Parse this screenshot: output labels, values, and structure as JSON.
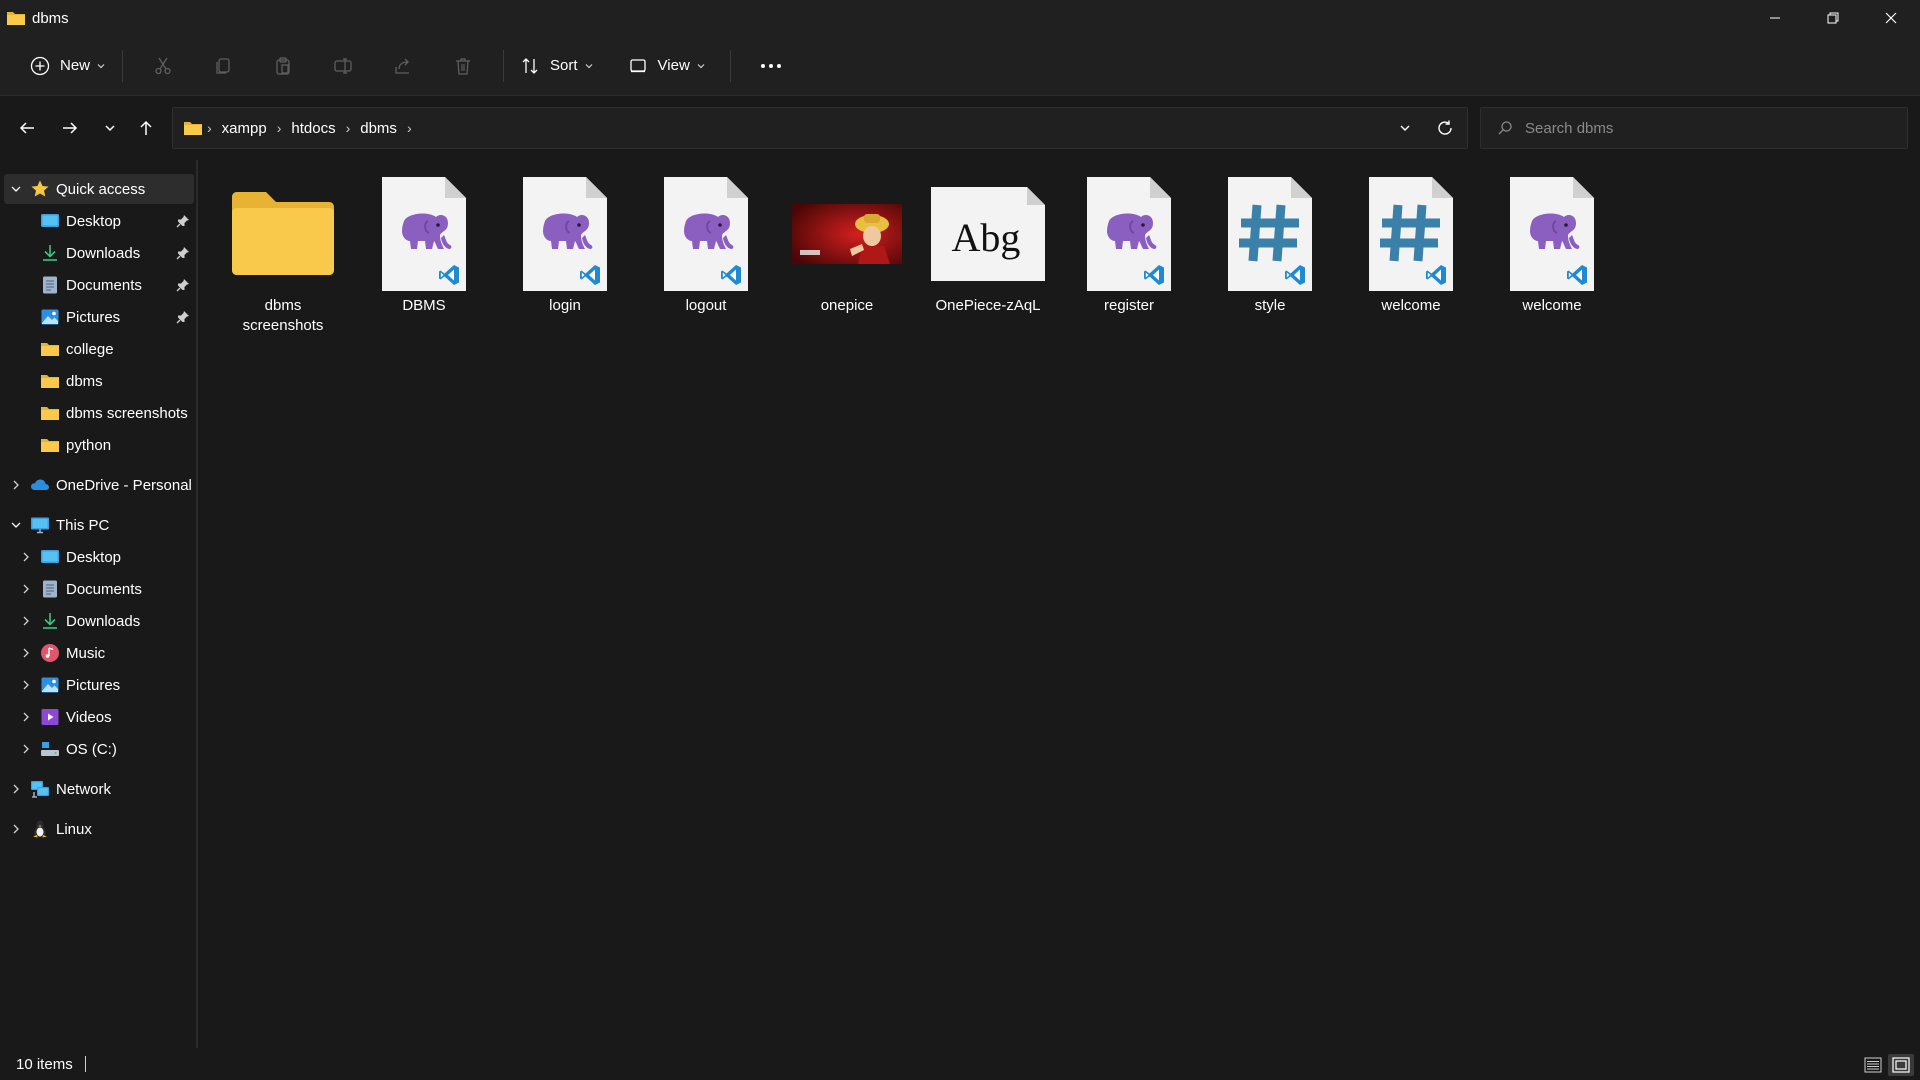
{
  "window": {
    "title": "dbms",
    "minimize_icon": "minimize-icon",
    "maximize_icon": "restore-icon",
    "close_icon": "close-icon"
  },
  "command_bar": {
    "new_label": "New",
    "sort_label": "Sort",
    "view_label": "View",
    "icons": [
      "cut-icon",
      "copy-icon",
      "paste-icon",
      "rename-icon",
      "share-icon",
      "delete-icon",
      "more-icon"
    ]
  },
  "address_bar": {
    "crumbs": [
      "xampp",
      "htdocs",
      "dbms"
    ],
    "search_placeholder": "Search dbms"
  },
  "sidebar": {
    "quick_access": {
      "label": "Quick access",
      "items": [
        {
          "label": "Desktop",
          "icon": "desktop-icon",
          "pinned": true
        },
        {
          "label": "Downloads",
          "icon": "downloads-icon",
          "pinned": true
        },
        {
          "label": "Documents",
          "icon": "documents-icon",
          "pinned": true
        },
        {
          "label": "Pictures",
          "icon": "pictures-icon",
          "pinned": true
        },
        {
          "label": "college",
          "icon": "folder-icon",
          "pinned": false
        },
        {
          "label": "dbms",
          "icon": "folder-icon",
          "pinned": false
        },
        {
          "label": "dbms screenshots",
          "icon": "folder-icon",
          "pinned": false
        },
        {
          "label": "python",
          "icon": "folder-icon",
          "pinned": false
        }
      ]
    },
    "onedrive": {
      "label": "OneDrive - Personal"
    },
    "this_pc": {
      "label": "This PC",
      "items": [
        {
          "label": "Desktop",
          "icon": "desktop-icon"
        },
        {
          "label": "Documents",
          "icon": "documents-icon"
        },
        {
          "label": "Downloads",
          "icon": "downloads-icon"
        },
        {
          "label": "Music",
          "icon": "music-icon"
        },
        {
          "label": "Pictures",
          "icon": "pictures-icon"
        },
        {
          "label": "Videos",
          "icon": "videos-icon"
        },
        {
          "label": "OS (C:)",
          "icon": "drive-icon"
        }
      ]
    },
    "network": {
      "label": "Network"
    },
    "linux": {
      "label": "Linux"
    }
  },
  "files": [
    {
      "name": "dbms screenshots",
      "type": "folder"
    },
    {
      "name": "DBMS",
      "type": "php"
    },
    {
      "name": "login",
      "type": "php"
    },
    {
      "name": "logout",
      "type": "php"
    },
    {
      "name": "onepice",
      "type": "image"
    },
    {
      "name": "OnePiece-zAqL",
      "type": "font"
    },
    {
      "name": "register",
      "type": "php"
    },
    {
      "name": "style",
      "type": "css"
    },
    {
      "name": "welcome",
      "type": "css"
    },
    {
      "name": "welcome",
      "type": "php"
    }
  ],
  "status": {
    "count": "10 items"
  },
  "colors": {
    "background": "#191919",
    "chrome": "#202020",
    "folder_yellow": "#f8c94a",
    "php_purple": "#8b5fbf",
    "css_teal": "#3b80a8",
    "vscode_blue": "#1f8ad2"
  }
}
